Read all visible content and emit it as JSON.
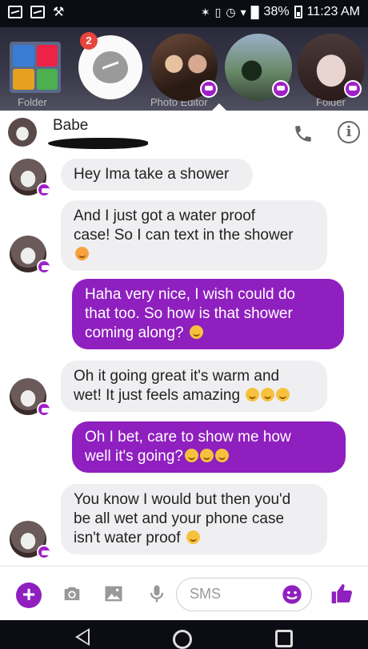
{
  "status_bar": {
    "battery": "38%",
    "time": "11:23 AM"
  },
  "home_screen": {
    "folder_left": "Folder",
    "folder_mid": "Photo Editor",
    "folder_right": "Folder"
  },
  "chat_heads": {
    "badge_count": "2"
  },
  "conversation": {
    "contact_name": "Babe"
  },
  "messages": [
    {
      "side": "in",
      "lines": [
        "Hey Ima take a shower"
      ]
    },
    {
      "side": "in",
      "lines": [
        "And I just got a water proof",
        "case! So I can text in the shower"
      ]
    },
    {
      "side": "out",
      "lines": [
        "Haha very nice, I wish could do",
        "that too. So how is that shower",
        "coming along?"
      ]
    },
    {
      "side": "in",
      "lines": [
        "Oh it going great it's warm and",
        "wet! It just feels amazing"
      ]
    },
    {
      "side": "out",
      "lines": [
        "Oh I bet, care to show me how",
        "well it's going?"
      ]
    },
    {
      "side": "in",
      "lines": [
        "You know I would but then you'd",
        "be all wet and your phone case",
        "isn't water proof"
      ]
    }
  ],
  "composer": {
    "placeholder": "SMS"
  },
  "colors": {
    "accent": "#8f1fbf",
    "incoming_bubble": "#efeff1"
  }
}
